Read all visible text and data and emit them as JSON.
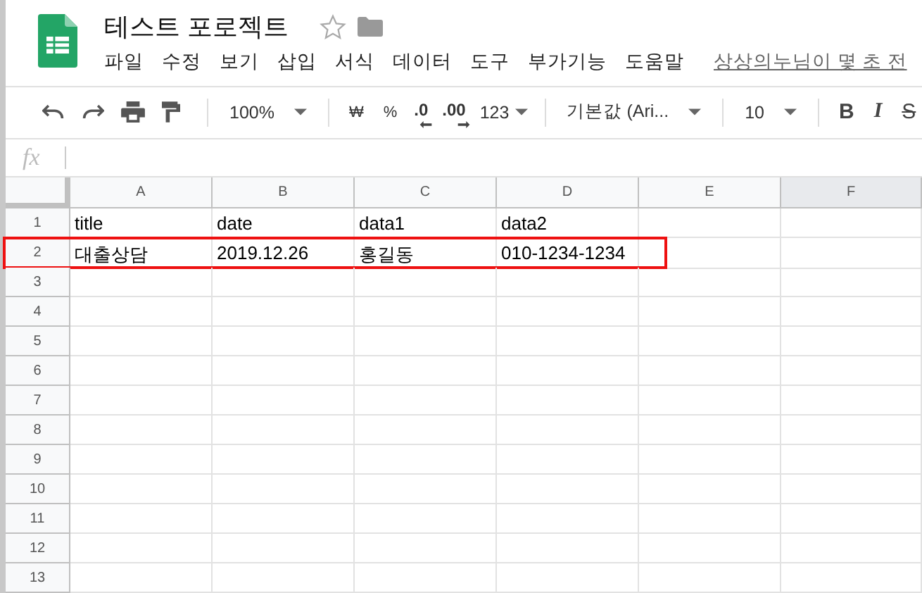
{
  "document": {
    "title": "테스트 포로젝트",
    "starred": false
  },
  "menu": [
    "파일",
    "수정",
    "보기",
    "삽입",
    "서식",
    "데이터",
    "도구",
    "부가기능",
    "도움말"
  ],
  "last_edit": "상상의누님이 몇 초 전",
  "toolbar": [
    {
      "kind": "dropdown",
      "label": "100%"
    },
    {
      "kind": "sep"
    },
    {
      "kind": "text",
      "label": "₩"
    },
    {
      "kind": "text",
      "label": "%"
    },
    {
      "kind": "decrease",
      "label": ".0"
    },
    {
      "kind": "increase",
      "label": ".00"
    },
    {
      "kind": "caret",
      "label": "123"
    },
    {
      "kind": "sep"
    },
    {
      "kind": "dropdown",
      "label": "기본값 (Ari..."
    },
    {
      "kind": "sep"
    },
    {
      "kind": "dropdown",
      "label": "10"
    },
    {
      "kind": "sep"
    },
    {
      "kind": "bold",
      "label": "B"
    },
    {
      "kind": "italic",
      "label": "I"
    },
    {
      "kind": "strike",
      "label": "S"
    }
  ],
  "formula_bar": {
    "label": "fx"
  },
  "columns": [
    {
      "label": "A",
      "selected": false
    },
    {
      "label": "B",
      "selected": false
    },
    {
      "label": "C",
      "selected": false
    },
    {
      "label": "D",
      "selected": false
    },
    {
      "label": "E",
      "selected": false
    },
    {
      "label": "F",
      "selected": true
    }
  ],
  "rows": [
    {
      "number": "1",
      "cells": [
        "title",
        "date",
        "data1",
        "data2"
      ],
      "highlighted": false
    },
    {
      "number": "2",
      "cells": [
        "대출상담",
        "2019.12.26",
        "홍길동",
        "010-1234-1234"
      ],
      "highlighted": true
    },
    {
      "number": "3",
      "highlighted": false
    },
    {
      "number": "4",
      "highlighted": false
    },
    {
      "number": "5",
      "highlighted": false
    },
    {
      "number": "6",
      "highlighted": false
    },
    {
      "number": "7",
      "highlighted": false
    },
    {
      "number": "8",
      "highlighted": false
    },
    {
      "number": "9",
      "highlighted": false
    },
    {
      "number": "10",
      "highlighted": false
    },
    {
      "number": "11",
      "highlighted": false
    },
    {
      "number": "12",
      "highlighted": false
    },
    {
      "number": "13",
      "highlighted": false
    }
  ]
}
